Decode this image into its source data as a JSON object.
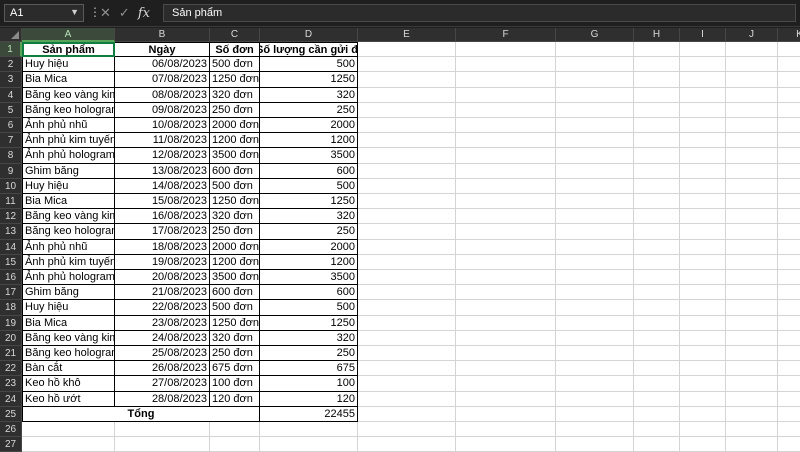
{
  "namebox": {
    "value": "A1"
  },
  "formula_bar": {
    "value": "Sản phẩm"
  },
  "columns": [
    "A",
    "B",
    "C",
    "D",
    "E",
    "F",
    "G",
    "H",
    "I",
    "J",
    "K"
  ],
  "header": {
    "product": "Sản phẩm",
    "date": "Ngày",
    "orders": "Số đơn",
    "qty": "Số lượng cần gửi đi"
  },
  "rows": [
    [
      "Huy hiệu",
      "06/08/2023",
      "500 đơn",
      "500"
    ],
    [
      "Bia Mica",
      "07/08/2023",
      "1250 đơn",
      "1250"
    ],
    [
      "Băng keo vàng kim",
      "08/08/2023",
      "320 đơn",
      "320"
    ],
    [
      "Băng keo hologram",
      "09/08/2023",
      "250 đơn",
      "250"
    ],
    [
      "Ảnh phủ nhũ",
      "10/08/2023",
      "2000 đơn",
      "2000"
    ],
    [
      "Ảnh phủ kim tuyến",
      "11/08/2023",
      "1200 đơn",
      "1200"
    ],
    [
      "Ảnh phủ hologram",
      "12/08/2023",
      "3500 đơn",
      "3500"
    ],
    [
      "Ghim băng",
      "13/08/2023",
      "600 đơn",
      "600"
    ],
    [
      "Huy hiệu",
      "14/08/2023",
      "500 đơn",
      "500"
    ],
    [
      "Bia Mica",
      "15/08/2023",
      "1250 đơn",
      "1250"
    ],
    [
      "Băng keo vàng kim",
      "16/08/2023",
      "320 đơn",
      "320"
    ],
    [
      "Băng keo hologram",
      "17/08/2023",
      "250 đơn",
      "250"
    ],
    [
      "Ảnh phủ nhũ",
      "18/08/2023",
      "2000 đơn",
      "2000"
    ],
    [
      "Ảnh phủ kim tuyến",
      "19/08/2023",
      "1200 đơn",
      "1200"
    ],
    [
      "Ảnh phủ hologram",
      "20/08/2023",
      "3500 đơn",
      "3500"
    ],
    [
      "Ghim băng",
      "21/08/2023",
      "600 đơn",
      "600"
    ],
    [
      "Huy hiệu",
      "22/08/2023",
      "500 đơn",
      "500"
    ],
    [
      "Bia Mica",
      "23/08/2023",
      "1250 đơn",
      "1250"
    ],
    [
      "Băng keo vàng kim",
      "24/08/2023",
      "320 đơn",
      "320"
    ],
    [
      "Băng keo hologram",
      "25/08/2023",
      "250 đơn",
      "250"
    ],
    [
      "Bàn cắt",
      "26/08/2023",
      "675 đơn",
      "675"
    ],
    [
      "Keo hồ khô",
      "27/08/2023",
      "100 đơn",
      "100"
    ],
    [
      "Keo hồ ướt",
      "28/08/2023",
      "120 đơn",
      "120"
    ]
  ],
  "total": {
    "label": "Tổng",
    "value": "22455"
  },
  "row_numbers": [
    "1",
    "2",
    "3",
    "4",
    "5",
    "6",
    "7",
    "8",
    "9",
    "10",
    "11",
    "12",
    "13",
    "14",
    "15",
    "16",
    "17",
    "18",
    "19",
    "20",
    "21",
    "22",
    "23",
    "24",
    "25",
    "26",
    "27"
  ],
  "icons": {
    "cancel": "close-icon",
    "confirm": "check-icon",
    "function": "fx-icon"
  },
  "colors": {
    "active_cell": "#107c41",
    "chrome": "#1f1f1f"
  }
}
